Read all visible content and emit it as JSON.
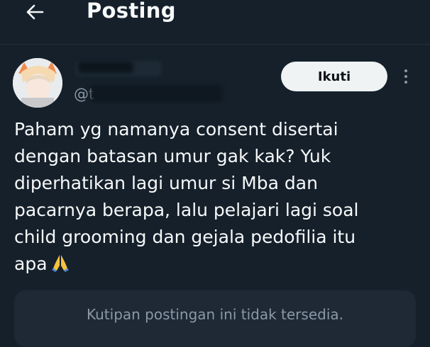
{
  "header": {
    "title": "Posting",
    "back_icon": "arrow-left-icon"
  },
  "author": {
    "handle": "@t"
  },
  "follow_button": {
    "label": "Ikuti"
  },
  "more_icon": "more-vertical-icon",
  "tweet": {
    "text": "Paham yg namanya consent disertai\ndengan batasan umur gak kak? Yuk\ndiperhatikan lagi umur si Mba dan\npacarnya berapa, lalu pelajari lagi soal\nchild grooming dan gejala pedofilia itu\napa",
    "emoji_icon": "folded-hands-icon"
  },
  "quote": {
    "unavailable_text": "Kutipan postingan ini tidak tersedia."
  },
  "colors": {
    "background": "#15202b",
    "text": "#f7f9f9",
    "muted": "#8b98a5",
    "button_bg": "#eff3f4",
    "quote_bg": "#1e2935"
  }
}
